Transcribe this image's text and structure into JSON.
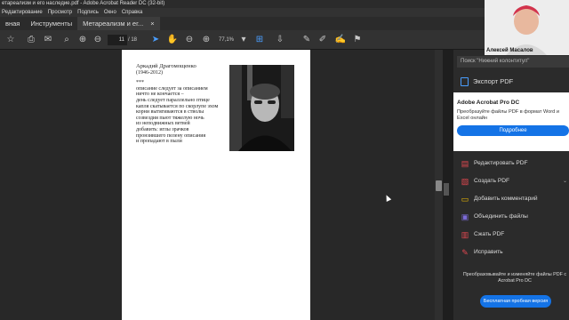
{
  "window": {
    "title": "етареализм и его наследие.pdf - Adobe Acrobat Reader DC (32-bit)"
  },
  "menu": [
    "Редактирование",
    "Просмотр",
    "Подпись",
    "Окно",
    "Справка"
  ],
  "tabs": {
    "home": "вная",
    "tools": "Инструменты",
    "doc": "Метареализм и ег...",
    "close": "×"
  },
  "toolbar": {
    "page_current": "11",
    "page_total": "/ 18",
    "zoom": "77,1%"
  },
  "poem": {
    "author": "Аркадий Драгомощенко",
    "years": "(1946-2012)",
    "stars": "***",
    "lines": [
      "описание следует за описанием",
      "ничто не кончается –",
      "день следует параллельно птице",
      "капля скатывается по скорлупе эхом",
      "корни вытягиваются в стволы",
      "созвездия пьют тяжелую ночь",
      "из неподвижных ветвей",
      "добавить: иглы зрачков",
      "пронзившего пелену описания",
      "и пропадают в пыли"
    ]
  },
  "sidebar": {
    "search_placeholder": "Поиск \"Нижний колонтитул\"",
    "export_label": "Экспорт PDF",
    "promo_title": "Adobe Acrobat Pro DC",
    "promo_desc": "Преобразуйте файлы PDF в формат Word и Excel онлайн",
    "promo_button": "Подробнее",
    "tools": [
      {
        "label": "Редактировать PDF",
        "icon": "edit-pdf-icon",
        "color": "#e34850"
      },
      {
        "label": "Создать PDF",
        "icon": "create-pdf-icon",
        "color": "#e34850"
      },
      {
        "label": "Добавить комментарий",
        "icon": "comment-icon",
        "color": "#f5c000"
      },
      {
        "label": "Объединить файлы",
        "icon": "combine-icon",
        "color": "#7c6bd9"
      },
      {
        "label": "Сжать PDF",
        "icon": "compress-icon",
        "color": "#e34850"
      },
      {
        "label": "Исправить",
        "icon": "redact-icon",
        "color": "#e34850"
      }
    ],
    "bottom_text": "Преобразовывайте и изменяйте файлы PDF с Acrobat Pro DC",
    "trial_button": "Бесплатная пробная версия"
  },
  "webcam": {
    "name": "Алексей Масалов"
  },
  "colors": {
    "accent": "#1473e6",
    "link": "#4a9eff"
  }
}
